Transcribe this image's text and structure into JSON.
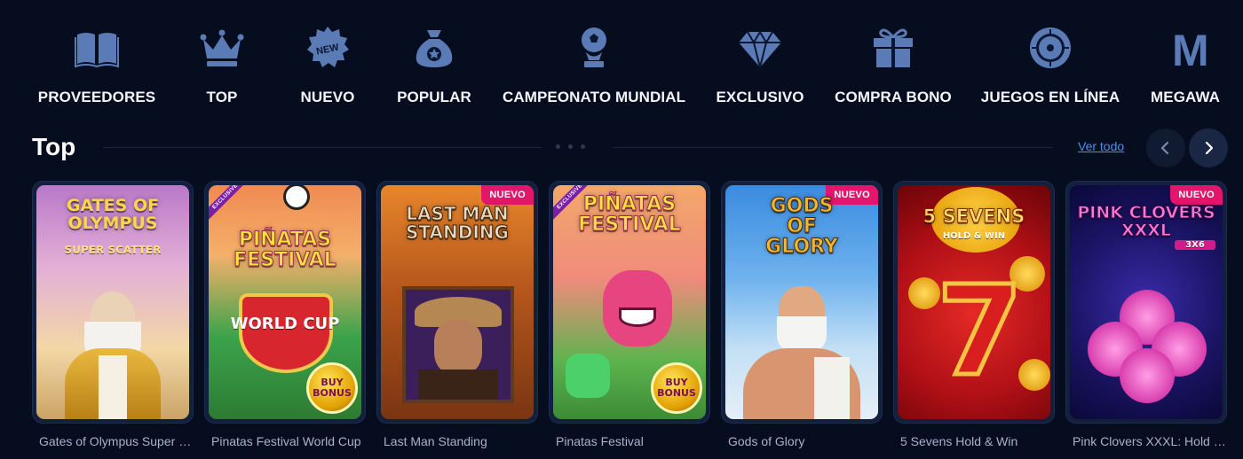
{
  "categories": [
    {
      "label": "PROVEEDORES",
      "icon": "book-icon"
    },
    {
      "label": "TOP",
      "icon": "crown-icon"
    },
    {
      "label": "NUEVO",
      "icon": "new-badge-icon",
      "icon_text": "NEW"
    },
    {
      "label": "POPULAR",
      "icon": "money-bag-icon"
    },
    {
      "label": "CAMPEONATO MUNDIAL",
      "icon": "trophy-icon"
    },
    {
      "label": "EXCLUSIVO",
      "icon": "diamond-icon"
    },
    {
      "label": "COMPRA BONO",
      "icon": "gift-icon"
    },
    {
      "label": "JUEGOS EN LÍNEA",
      "icon": "roulette-icon"
    },
    {
      "label": "MEGAWA",
      "icon": "megaways-icon",
      "icon_text": "M"
    }
  ],
  "section": {
    "title": "Top",
    "see_all": "Ver todo",
    "prev_icon": "chevron-left-icon",
    "next_icon": "chevron-right-icon"
  },
  "badges": {
    "new": "NUEVO",
    "exclusive": "EXCLUSIVE",
    "buy_bonus": "BUY BONUS"
  },
  "games": [
    {
      "name": "Gates of Olympus Super Scatter",
      "art_title": "Gates of Olympus",
      "art_sub": "Super Scatter",
      "new": false,
      "exclusive": false,
      "buy_bonus": false
    },
    {
      "name": "Pinatas Festival World Cup",
      "art_title": "Piñatas Festival",
      "art_sub": "World Cup",
      "new": false,
      "exclusive": true,
      "buy_bonus": true
    },
    {
      "name": "Last Man Standing",
      "art_title": "Last Man Standing",
      "art_sub": "",
      "new": true,
      "exclusive": false,
      "buy_bonus": false
    },
    {
      "name": "Pinatas Festival",
      "art_title": "Piñatas Festival",
      "art_sub": "",
      "new": false,
      "exclusive": true,
      "buy_bonus": true
    },
    {
      "name": "Gods of Glory",
      "art_title": "Gods of Glory",
      "art_sub": "",
      "new": true,
      "exclusive": false,
      "buy_bonus": false
    },
    {
      "name": "5 Sevens Hold & Win",
      "art_title": "5 Sevens",
      "art_sub": "Hold & Win",
      "new": false,
      "exclusive": false,
      "buy_bonus": false
    },
    {
      "name": "Pink Clovers XXXL: Hold & Win",
      "art_title": "Pink Clovers XXXL",
      "art_sub": "3x6",
      "new": true,
      "exclusive": false,
      "buy_bonus": false
    }
  ],
  "colors": {
    "background": "#050d1f",
    "icon": "#5a7bb5",
    "accent_link": "#4d8fea",
    "badge_new": "#e3166b"
  }
}
